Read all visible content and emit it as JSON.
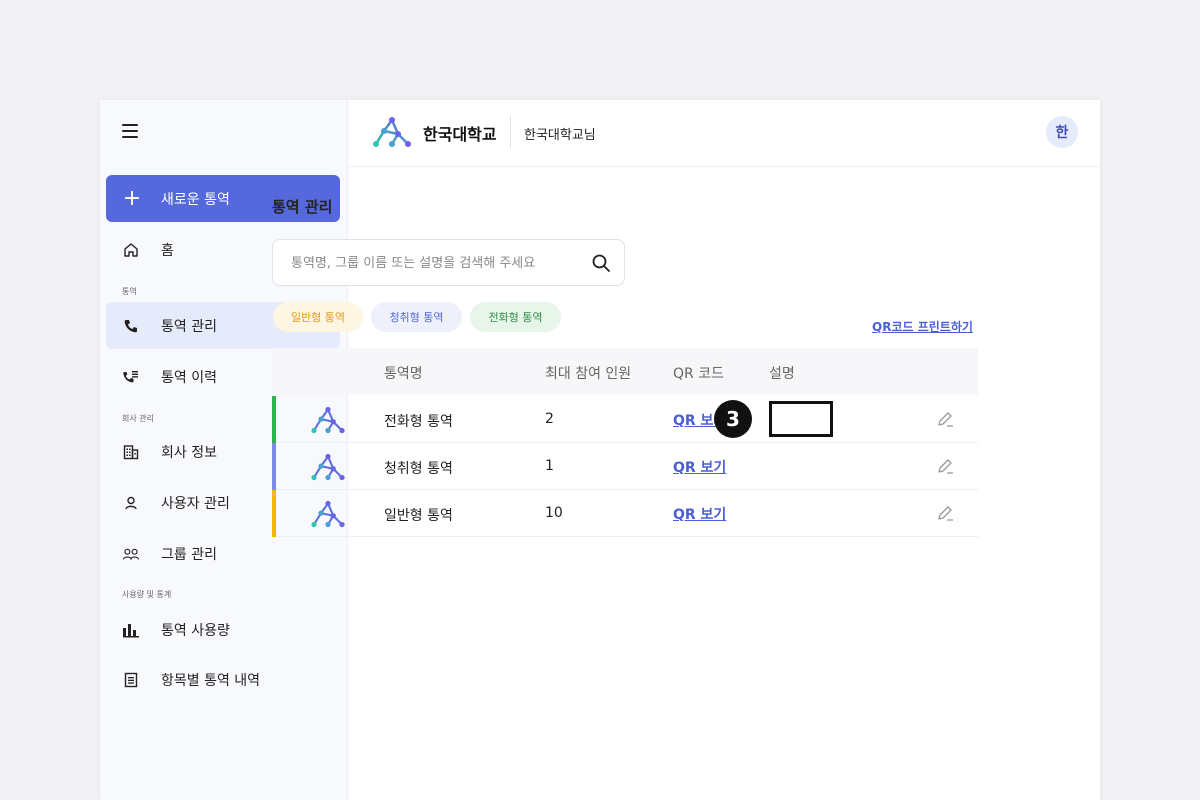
{
  "sidebar": {
    "new_button": "새로운 통역",
    "home": "홈",
    "section_interp": "통역",
    "interp_manage": "통역 관리",
    "interp_history": "통역 이력",
    "section_company": "회사 관리",
    "company_info": "회사 정보",
    "user_manage": "사용자 관리",
    "group_manage": "그룹 관리",
    "section_usage": "사용량 및 통계",
    "usage": "통역 사용량",
    "item_history": "항목별 통역 내역"
  },
  "header": {
    "brand": "한국대학교",
    "user": "한국대학교님",
    "avatar": "한"
  },
  "main": {
    "title": "통역 관리",
    "search_placeholder": "통역명, 그룹 이름 또는 설명을 검색해 주세요",
    "filters": [
      "일반형 통역",
      "청취형 통역",
      "전화형 통역"
    ],
    "print_link": "QR코드 프린트하기",
    "columns": [
      "통역명",
      "최대 참여 인원",
      "QR 코드",
      "설명"
    ],
    "rows": [
      {
        "name": "전화형 통역",
        "max": "2",
        "qr": "QR 보기",
        "color": "#2db34a"
      },
      {
        "name": "청취형 통역",
        "max": "1",
        "qr": "QR 보기",
        "color": "#7d8be6"
      },
      {
        "name": "일반형 통역",
        "max": "10",
        "qr": "QR 보기",
        "color": "#f5b800"
      }
    ]
  },
  "annotation": {
    "step": "3"
  },
  "colors": {
    "accent": "#5568dc",
    "link": "#4a5fd6",
    "active_bg": "#e5ebfa"
  }
}
